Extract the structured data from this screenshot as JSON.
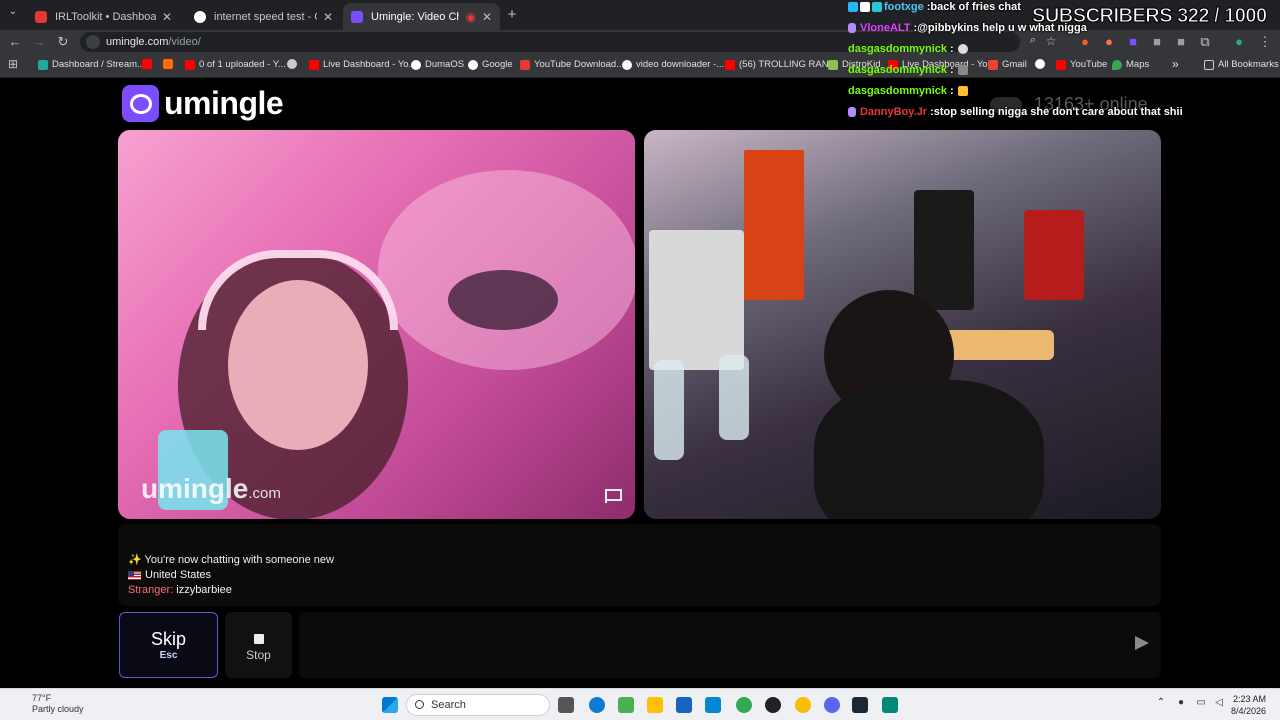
{
  "browser": {
    "tabs": [
      {
        "title": "IRLToolkit • Dashboard",
        "color": "#e53935",
        "active": false
      },
      {
        "title": "internet speed test - Google Se",
        "color": "#ffffff",
        "active": false
      },
      {
        "title": "Umingle: Video Chat with S",
        "color": "#7c4dff",
        "active": true
      }
    ],
    "new_tab": "+",
    "back": "←",
    "forward": "→",
    "reload": "↻",
    "url_domain": "umingle.com",
    "url_path": "/video/",
    "bookmarks": [
      {
        "label": "Dashboard / Stream...",
        "color": "#26a69a"
      },
      {
        "label": "",
        "color": "#ff0000"
      },
      {
        "label": "",
        "color": "#ff6d00"
      },
      {
        "label": "0 of 1 uploaded - Y...",
        "color": "#ff0000"
      },
      {
        "label": "",
        "color": "#cccccc"
      },
      {
        "label": "Live Dashboard - Yo...",
        "color": "#ff0000"
      },
      {
        "label": "DumaOS",
        "color": "#ffffff"
      },
      {
        "label": "Google",
        "color": "#ffffff"
      },
      {
        "label": "YouTube Download...",
        "color": "#e53935"
      },
      {
        "label": "video downloader -...",
        "color": "#ffffff"
      },
      {
        "label": "(56) TROLLING RAN...",
        "color": "#ff0000"
      },
      {
        "label": "DistroKid",
        "color": "#8bc34a"
      },
      {
        "label": "Live Dashboard - Yo...",
        "color": "#ff0000"
      },
      {
        "label": "Gmail",
        "color": "#ea4335"
      },
      {
        "label": "",
        "color": "#ffffff"
      },
      {
        "label": "YouTube",
        "color": "#ff0000"
      },
      {
        "label": "Maps",
        "color": "#34a853"
      }
    ],
    "more": "»",
    "all_bookmarks": "All Bookmarks"
  },
  "site": {
    "logo": "umingle",
    "online_count": "13163+ online",
    "watermark": "umingle",
    "watermark_suffix": ".com",
    "chat_lines": {
      "new_chat": "✨ You're now chatting with someone new",
      "country": "United States",
      "stranger_label": "Stranger:",
      "stranger_name": "izzybarbiee"
    },
    "skip_label": "Skip",
    "skip_key": "Esc",
    "stop_label": "Stop",
    "message_placeholder": ""
  },
  "overlay": {
    "sub_goal": "SUBSCRIBERS 322 / 1000",
    "messages": [
      {
        "name": "footxge",
        "text": "back of fries chat",
        "name_color": "#4fc3f7"
      },
      {
        "name": "VloneALT",
        "text": "@pibbykins help u w what nigga",
        "name_color": "#e040fb"
      },
      {
        "name": "dasgasdommynick",
        "text": "",
        "name_color": "#76ff03"
      },
      {
        "name": "dasgasdommynick",
        "text": "",
        "name_color": "#76ff03"
      },
      {
        "name": "dasgasdommynick",
        "text": "",
        "name_color": "#76ff03"
      },
      {
        "name": "DannyBoy.Jr",
        "text": "stop selling nigga she don't care about that shii",
        "name_color": "#e53935"
      }
    ]
  },
  "taskbar": {
    "weather_temp": "77°F",
    "weather_desc": "Partly cloudy",
    "search_label": "Search",
    "time": "2:23 AM",
    "date": "8/4/2026"
  }
}
